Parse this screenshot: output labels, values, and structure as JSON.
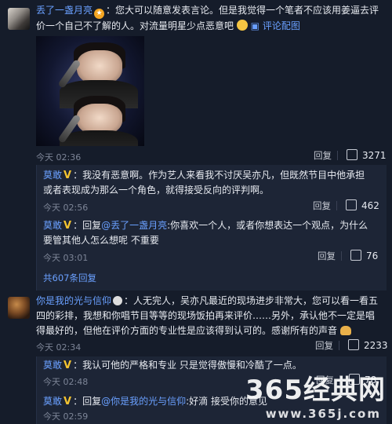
{
  "comments": [
    {
      "username": "丢了一盏月亮",
      "badge_icon": "gold-medal-icon",
      "text": "：您大可以随意发表言论。但是我觉得一个笔者不应该用姜逼去评价一个自己不了解的人。对流量明星少点恶意吧",
      "emoji_icon": "smile-emoji-icon",
      "pic_link": "评论配图",
      "time": "今天 02:36",
      "reply_label": "回复",
      "likes": "3271",
      "replies": [
        {
          "username": "莫敢",
          "text": "：我没有恶意啊。作为艺人来看我不讨厌吴亦凡，但既然节目中他承担或者表现成为那么一个角色，就得接受反向的评判啊。",
          "time": "今天 02:56",
          "reply_label": "回复",
          "likes": "462"
        },
        {
          "username": "莫敢",
          "reply_prefix": "：回复",
          "reply_to": "@丢了一盏月亮",
          "text": ":你喜欢一个人，或者你想表达一个观点，为什么要管其他人怎么想呢 不重要",
          "time": "今天 03:01",
          "reply_label": "回复",
          "likes": "76"
        }
      ],
      "more_replies": "共607条回复"
    },
    {
      "username": "你是我的光与信仰",
      "text": "：人无完人，吴亦凡最近的现场进步非常大，您可以看一看五四的彩排，我想和你唱节目等等的现场饭拍再来评价……另外，承认他不一定是唱得最好的，但他在评价方面的专业性是应该得到认可的。感谢所有的声音",
      "time": "今天 02:34",
      "reply_label": "回复",
      "likes": "2233",
      "replies": [
        {
          "username": "莫敢",
          "text": "：我认可他的严格和专业 只是觉得傲慢和冷酷了一点。",
          "time": "今天 02:48",
          "reply_label": "回复",
          "likes": "78"
        },
        {
          "username": "莫敢",
          "reply_prefix": "：回复",
          "reply_to": "@你是我的光与信仰",
          "text": ":好滴 接受你的意见",
          "time": "今天 02:59",
          "reply_label": "回复",
          "likes": ""
        }
      ]
    }
  ],
  "watermark": {
    "text": "365经典网",
    "url": "www.365j.com"
  }
}
